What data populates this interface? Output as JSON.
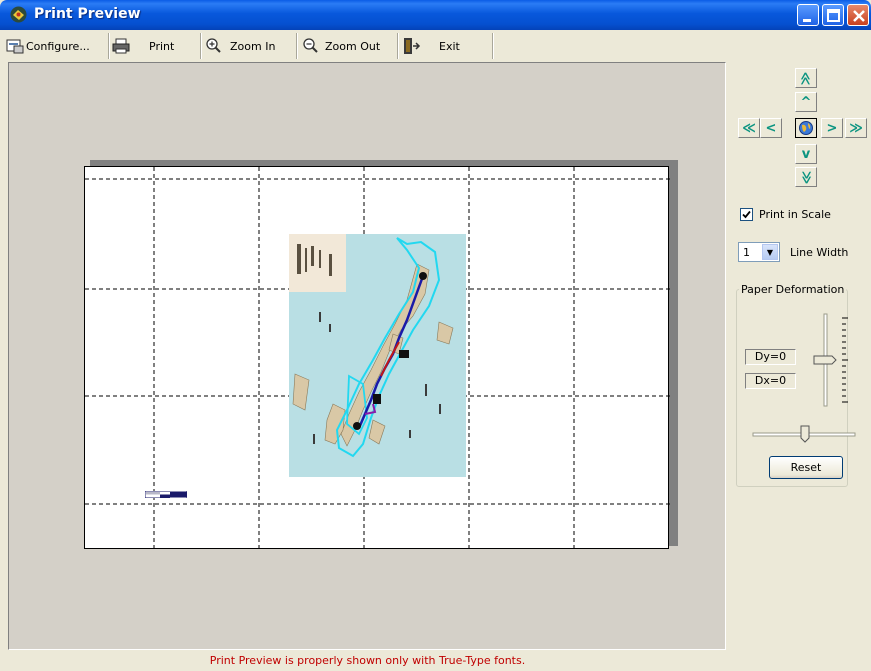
{
  "window": {
    "title": "Print Preview",
    "colors": {
      "titlebar": "#0a5ce6",
      "status_text": "#c00000",
      "nav_arrows": "#0b9480"
    }
  },
  "toolbar": {
    "configure": {
      "label": "Configure...",
      "icon": "printer-setup-icon"
    },
    "print": {
      "label": "Print",
      "icon": "printer-icon"
    },
    "zoom_in": {
      "label": "Zoom In",
      "icon": "magnifier-plus-icon"
    },
    "zoom_out": {
      "label": "Zoom Out",
      "icon": "magnifier-minus-icon"
    },
    "exit": {
      "label": "Exit",
      "icon": "exit-door-icon"
    }
  },
  "status_message": "Print Preview is properly shown only with True-Type fonts.",
  "navigation": {
    "page_up": "≫",
    "up": "^",
    "far_left": "≪",
    "left": "<",
    "center_icon": "globe-icon",
    "right": ">",
    "far_right": "≫",
    "down": "v",
    "page_down": "≫"
  },
  "print_in_scale": {
    "label": "Print in Scale",
    "checked": true
  },
  "line_width": {
    "label": "Line Width",
    "value": "1"
  },
  "paper_deformation": {
    "title": "Paper Deformation",
    "dy": "Dy=0",
    "dx": "Dx=0",
    "reset_label": "Reset"
  }
}
